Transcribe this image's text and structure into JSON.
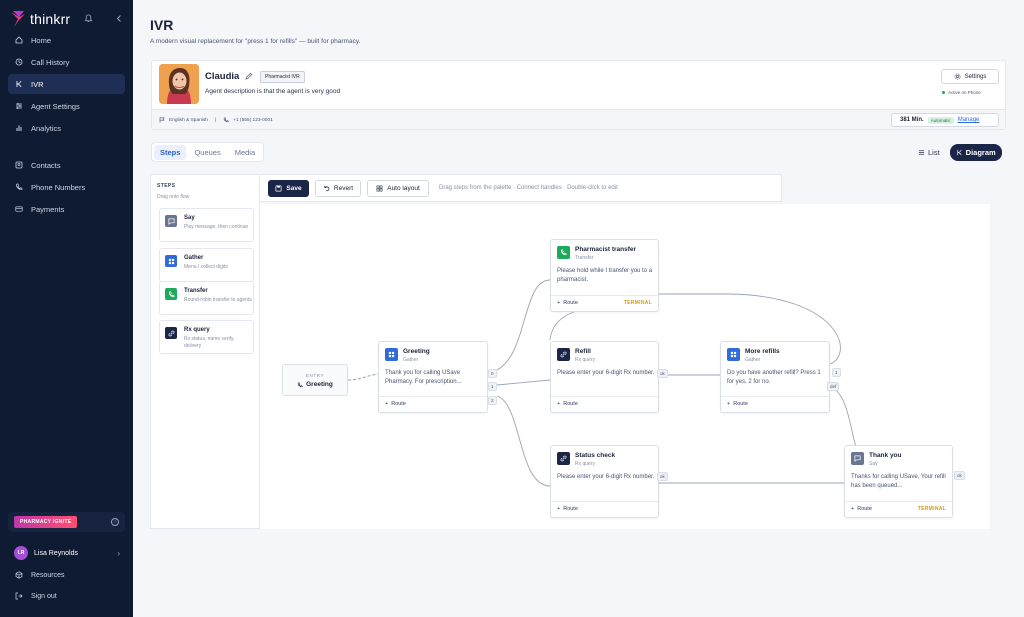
{
  "brand": {
    "name": "thinkrr"
  },
  "nav": [
    {
      "label": "Home"
    },
    {
      "label": "Call History"
    },
    {
      "label": "IVR"
    },
    {
      "label": "Agent Settings"
    },
    {
      "label": "Analytics"
    },
    {
      "label": "Contacts"
    },
    {
      "label": "Phone Numbers"
    },
    {
      "label": "Payments"
    }
  ],
  "ignite": {
    "label": "PHARMACY IGNITE"
  },
  "user": {
    "initials": "LR",
    "name": "Lisa Reynolds"
  },
  "footer": {
    "resources": "Resources",
    "signout": "Sign out"
  },
  "page": {
    "title": "IVR",
    "subtitle": "A modern visual replacement for \"press 1 for refills\" — built for pharmacy."
  },
  "agent": {
    "name": "Claudia",
    "tag": "Pharmacist IVR",
    "description": "Agent description is that the agent is very good",
    "settings_label": "Settings",
    "status": "Active on Phone",
    "languages": "English & Spanish",
    "phone": "+1 (555) 123-0001",
    "minutes": "381 Min.",
    "auto_label": "Automatic",
    "manage_label": "Manage"
  },
  "tabs": [
    {
      "label": "Steps"
    },
    {
      "label": "Queues"
    },
    {
      "label": "Media"
    }
  ],
  "view": {
    "list": "List",
    "diagram": "Diagram"
  },
  "steps_panel": {
    "label": "STEPS",
    "hint": "Drag onto flow",
    "items": [
      {
        "title": "Say",
        "desc": "Play message, then continue"
      },
      {
        "title": "Gather",
        "desc": "Menu / collect digits"
      },
      {
        "title": "Transfer",
        "desc": "Round-robin transfer to agents"
      },
      {
        "title": "Rx query",
        "desc": "Rx status, name verify, delivery"
      }
    ]
  },
  "toolbar": {
    "save": "Save",
    "revert": "Revert",
    "auto_layout": "Auto layout",
    "hint": "Drag steps from the palette · Connect handles · Double-click to edit"
  },
  "entry": {
    "label": "ENTRY",
    "name": "Greeting"
  },
  "nodes": {
    "pharmacist": {
      "title": "Pharmacist transfer",
      "type": "Transfer",
      "body": "Please hold while I transfer you to a pharmacist.",
      "route": "Route",
      "terminal": "TERMINAL"
    },
    "greeting": {
      "title": "Greeting",
      "type": "Gather",
      "body": "Thank you for calling USave Pharmacy. For prescription...",
      "route": "Route"
    },
    "refill": {
      "title": "Refill",
      "type": "Rx query",
      "body": "Please enter your 6-digit Rx number.",
      "route": "Route"
    },
    "more": {
      "title": "More refills",
      "type": "Gather",
      "body": "Do you have another refill? Press 1 for yes, 2 for no.",
      "route": "Route"
    },
    "status": {
      "title": "Status check",
      "type": "Rx query",
      "body": "Please enter your 6-digit Rx number.",
      "route": "Route"
    },
    "thanks": {
      "title": "Thank you",
      "type": "Say",
      "body": "Thanks for calling USave. Your refill has been queued...",
      "route": "Route",
      "terminal": "TERMINAL"
    }
  },
  "ports": {
    "g0": "0",
    "g1": "1",
    "g2": "2",
    "r_ok": "ok",
    "m1": "1",
    "mdef": "def",
    "s_ok": "ok",
    "t_ok": "ok"
  },
  "colors": {
    "sidebar": "#0f1a33",
    "accent": "#1b2547",
    "gather": "#2f6bde",
    "transfer": "#1eaa5c",
    "rx": "#1b2547",
    "say": "#6a7591",
    "terminal": "#d39b13"
  }
}
